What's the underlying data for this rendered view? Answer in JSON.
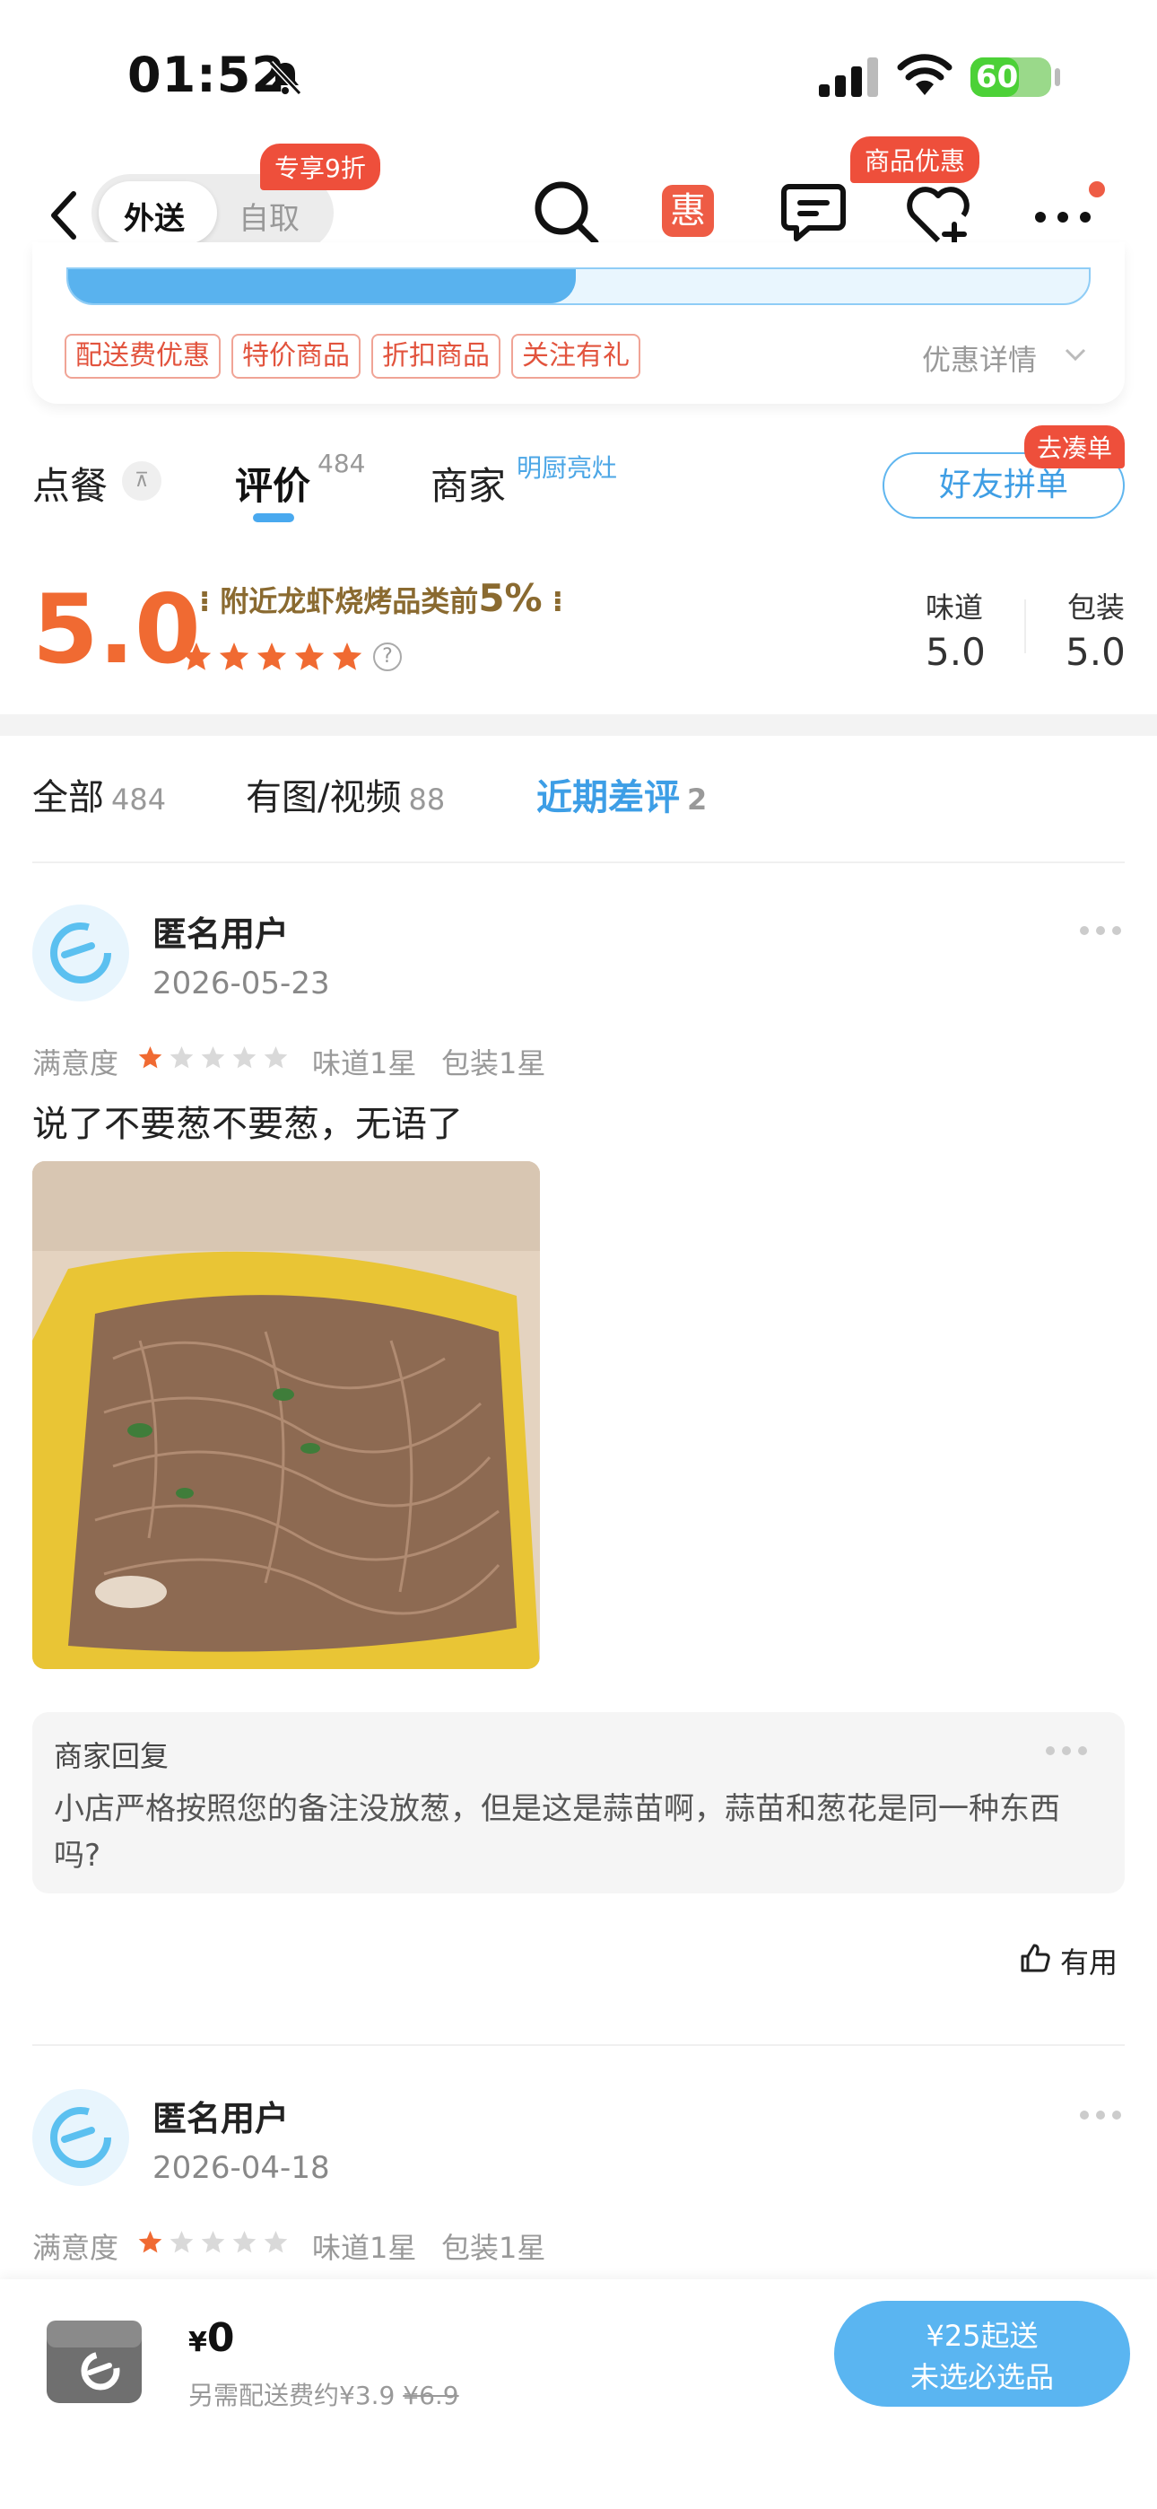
{
  "status_bar": {
    "time": "01:52",
    "battery": "60",
    "battery_level": 0.6
  },
  "nav": {
    "mode_delivery": "外送",
    "mode_pickup": "自取",
    "mode_promo": "专享9折",
    "favorite_promo": "商品优惠",
    "hui_label": "惠"
  },
  "promo": {
    "tags": [
      "配送费优惠",
      "特价商品",
      "折扣商品",
      "关注有礼"
    ],
    "detail": "优惠详情"
  },
  "main_tabs": {
    "order": "点餐",
    "reviews": "评价",
    "reviews_count": "484",
    "merchant": "商家",
    "merchant_sub": "明厨亮灶",
    "group_order": "好友拼单",
    "group_tag": "去凑单"
  },
  "rating": {
    "score": "5.0",
    "rank_prefix": "附近龙虾烧烤品类前",
    "rank_pct": "5%",
    "stars": 5,
    "taste_label": "味道",
    "taste_score": "5.0",
    "pack_label": "包装",
    "pack_score": "5.0"
  },
  "filters": [
    {
      "label": "全部",
      "count": "484"
    },
    {
      "label": "有图/视频",
      "count": "88"
    },
    {
      "label": "近期差评",
      "count": "2"
    }
  ],
  "reviews": [
    {
      "user": "匿名用户",
      "date": "2026-05-23",
      "sat_label": "满意度",
      "stars": 1,
      "taste": "味道1星",
      "pack": "包装1星",
      "text": "说了不要葱不要葱，无语了",
      "reply_title": "商家回复",
      "reply_text": "小店严格按照您的备注没放葱，但是这是蒜苗啊，蒜苗和葱花是同一种东西吗?",
      "useful": "有用"
    },
    {
      "user": "匿名用户",
      "date": "2026-04-18",
      "sat_label": "满意度",
      "stars": 1,
      "taste": "味道1星",
      "pack": "包装1星"
    }
  ],
  "cart": {
    "currency": "¥",
    "price": "0",
    "fee_text": "另需配送费约¥3.9",
    "fee_original": "¥6.9",
    "min_order_line1": "¥25起送",
    "min_order_line2": "未选必选品"
  },
  "colors": {
    "accent": "#49a9ef",
    "brand_red": "#ee4f3b",
    "rating_orange": "#f06a32"
  }
}
